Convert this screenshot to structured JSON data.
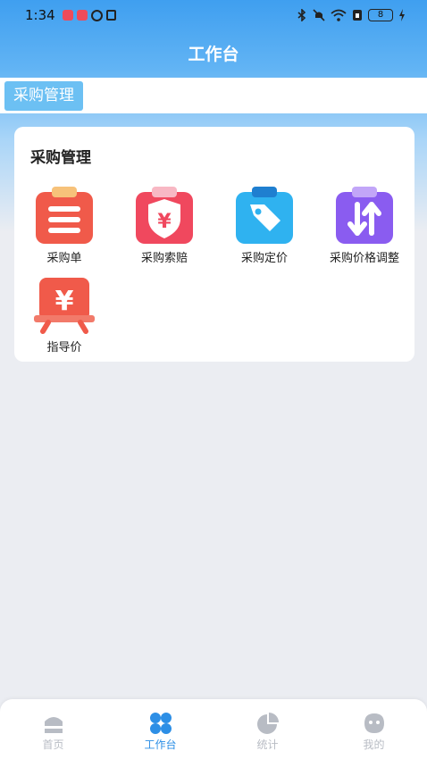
{
  "status_bar": {
    "time": "1:34",
    "battery": "8"
  },
  "header": {
    "title": "工作台"
  },
  "tab": {
    "label": "采购管理"
  },
  "section": {
    "title": "采购管理",
    "items": [
      {
        "label": "采购单",
        "icon": "clipboard-list-icon",
        "color": "#f05a4a"
      },
      {
        "label": "采购索赔",
        "icon": "yen-shield-icon",
        "color": "#f0485e"
      },
      {
        "label": "采购定价",
        "icon": "price-tag-icon",
        "color": "#2fb2f0"
      },
      {
        "label": "采购价格调整",
        "icon": "arrows-updown-icon",
        "color": "#8a5cf0"
      },
      {
        "label": "指导价",
        "icon": "yen-board-icon",
        "color": "#f05a4a"
      }
    ]
  },
  "bottom_nav": {
    "items": [
      {
        "label": "首页",
        "icon": "home-icon"
      },
      {
        "label": "工作台",
        "icon": "workbench-icon"
      },
      {
        "label": "统计",
        "icon": "pie-chart-icon"
      },
      {
        "label": "我的",
        "icon": "profile-icon"
      }
    ],
    "active_color": "#2d8fe6",
    "inactive_color": "#b8bcc4"
  }
}
